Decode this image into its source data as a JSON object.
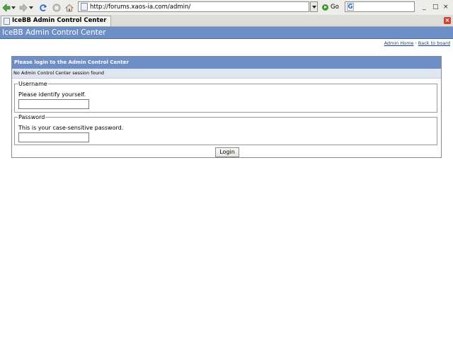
{
  "browser": {
    "url": "http://forums.xaos-ia.com/admin/",
    "go_label": "Go",
    "search_value": "",
    "tab_title": "IceBB Admin Control Center",
    "window_controls": [
      "_",
      "□",
      "×"
    ]
  },
  "page": {
    "header_title": "IceBB Admin Control Center",
    "links": {
      "admin_home": "Admin Home",
      "separator": "·",
      "back_to_board": "Back to board"
    }
  },
  "login": {
    "panel_title": "Please login to the Admin Control Center",
    "message": "No Admin Control Center session found",
    "username": {
      "legend": "Username",
      "description": "Please identify yourself.",
      "value": ""
    },
    "password": {
      "legend": "Password",
      "description": "This is your case-sensitive password.",
      "value": ""
    },
    "submit_label": "Login"
  },
  "colors": {
    "header_blue": "#6d8ec6",
    "message_bg": "#dfe6f2",
    "go_green": "#3c9a2d",
    "tab_close_red": "#d2432f"
  },
  "icons": [
    "back-arrow-icon",
    "forward-arrow-icon",
    "reload-icon",
    "stop-icon",
    "home-icon",
    "favicon-icon",
    "go-icon",
    "search-engine-icon",
    "tab-close-icon"
  ]
}
